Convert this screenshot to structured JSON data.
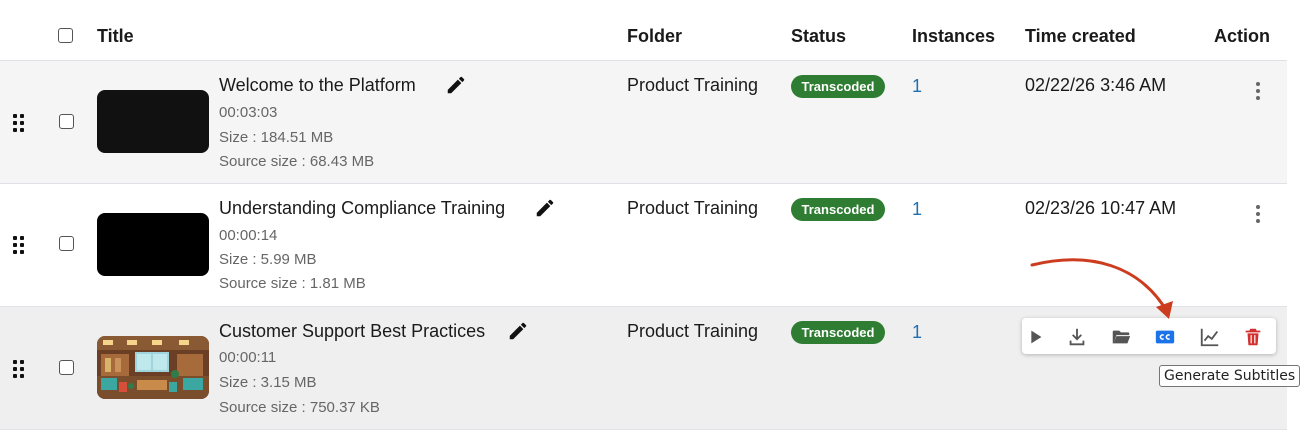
{
  "header": {
    "title": "Title",
    "folder": "Folder",
    "status": "Status",
    "instances": "Instances",
    "time_created": "Time created",
    "action": "Action"
  },
  "rows": [
    {
      "title": "Welcome to the Platform",
      "duration": "00:03:03",
      "size": "Size : 184.51 MB",
      "source_size": "Source size : 68.43 MB",
      "folder": "Product Training",
      "status": "Transcoded",
      "instances": "1",
      "time_created": "02/22/26 3:46 AM"
    },
    {
      "title": "Understanding Compliance Training",
      "duration": "00:00:14",
      "size": "Size : 5.99 MB",
      "source_size": "Source size : 1.81 MB",
      "folder": "Product Training",
      "status": "Transcoded",
      "instances": "1",
      "time_created": "02/23/26 10:47 AM"
    },
    {
      "title": "Customer Support Best Practices",
      "duration": "00:00:11",
      "size": "Size : 3.15 MB",
      "source_size": "Source size : 750.37 KB",
      "folder": "Product Training",
      "status": "Transcoded",
      "instances": "1",
      "time_created": ""
    }
  ],
  "action_icons": [
    "play-icon",
    "download-icon",
    "folder-icon",
    "closed-captions-icon",
    "analytics-chart-icon",
    "trash-icon"
  ],
  "tooltip": "Generate Subtitles",
  "colors": {
    "status_badge": "#2e7d32",
    "instances_link": "#1f6fb2",
    "cc_accent": "#1a73e8",
    "delete": "#d32f2f",
    "annotation_arrow": "#cc3d1f"
  }
}
